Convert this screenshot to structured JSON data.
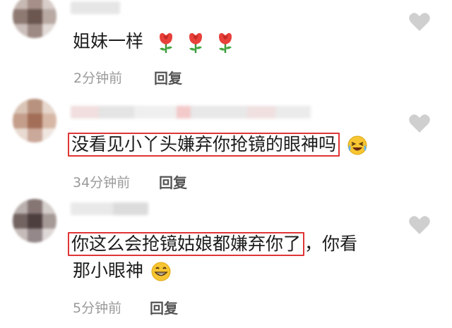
{
  "comments": [
    {
      "text": "姐妹一样",
      "emojis": [
        "rose-emoji",
        "rose-emoji",
        "rose-emoji"
      ],
      "time": "2分钟前",
      "reply": "回复"
    },
    {
      "highlighted_text": "没看见小丫头嫌弃你抢镜的眼神吗",
      "emojis": [
        "laughing-crying-emoji"
      ],
      "time": "34分钟前",
      "reply": "回复"
    },
    {
      "highlighted_text": "你这么会抢镜姑娘都嫌弃你了",
      "text_after": "，你看",
      "line2": "那小眼神",
      "emojis": [
        "grinning-emoji"
      ],
      "time": "5分钟前",
      "reply": "回复"
    }
  ],
  "colors": {
    "highlight_border": "#e03535",
    "heart": "#cfcfcf",
    "meta_text": "#9a9a9a"
  }
}
